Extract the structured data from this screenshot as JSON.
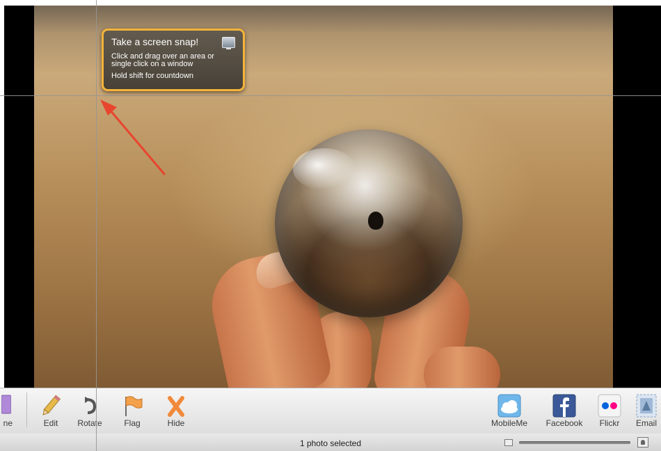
{
  "tooltip": {
    "title": "Take a screen snap!",
    "line1": "Click and drag over an area or",
    "line2": "single click on a window",
    "line3": "Hold shift for countdown",
    "accent": "#f4b33a"
  },
  "toolbar": {
    "left_items": [
      {
        "label": "ne",
        "icon": "partial-app-icon"
      },
      {
        "label": "Edit",
        "icon": "pencil-icon"
      },
      {
        "label": "Rotate",
        "icon": "rotate-icon"
      },
      {
        "label": "Flag",
        "icon": "flag-icon"
      },
      {
        "label": "Hide",
        "icon": "hide-x-icon"
      }
    ],
    "right_items": [
      {
        "label": "MobileMe",
        "icon": "cloud-icon"
      },
      {
        "label": "Facebook",
        "icon": "facebook-icon"
      },
      {
        "label": "Flickr",
        "icon": "flickr-icon"
      },
      {
        "label": "Email",
        "icon": "email-stamp-icon"
      }
    ]
  },
  "status": {
    "text": "1 photo selected"
  },
  "colors": {
    "arrow": "#e8452f",
    "facebook": "#3b5998",
    "flickr_pink": "#ff0084",
    "flickr_blue": "#0063dc"
  }
}
